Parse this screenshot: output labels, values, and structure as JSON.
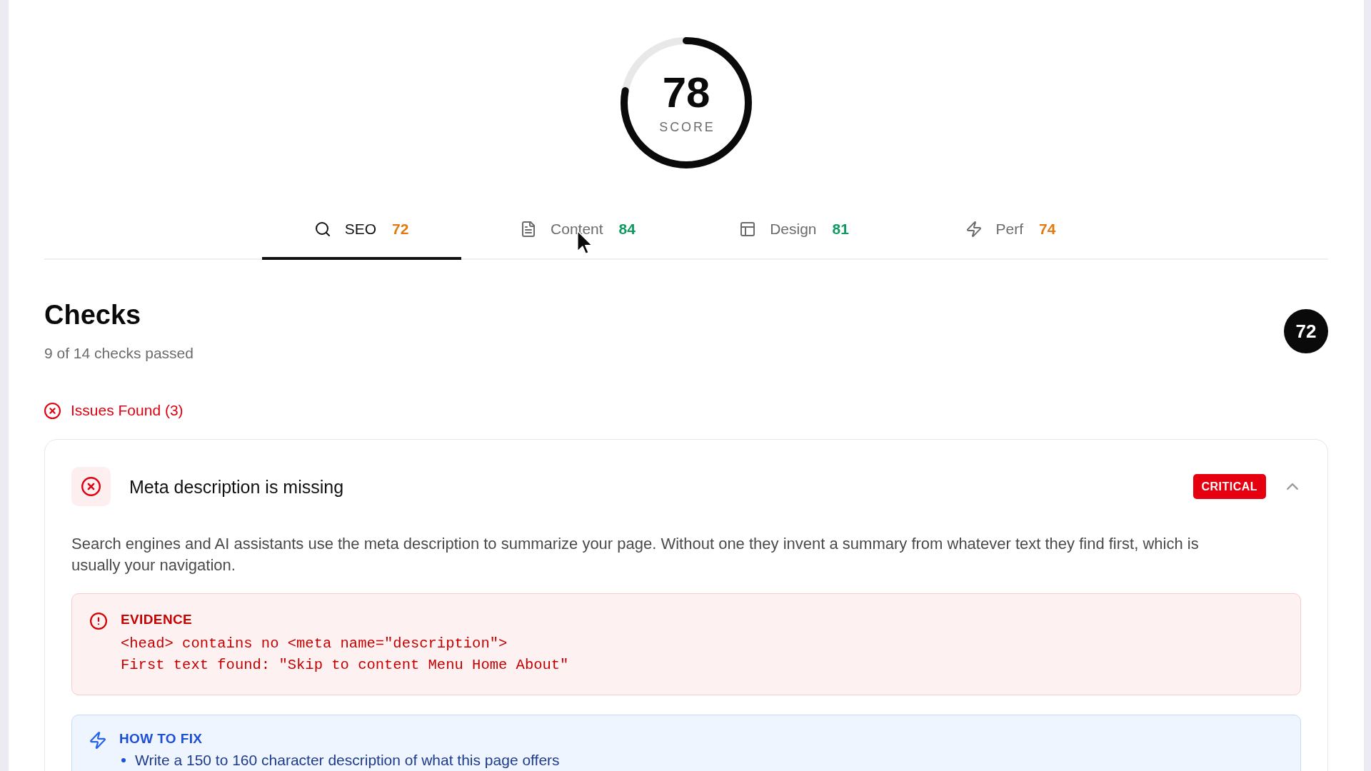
{
  "score": {
    "value": "78",
    "label": "SCORE",
    "level": 0.78
  },
  "tabs": [
    {
      "label": "SEO",
      "score": "72",
      "color": "#e27a0f",
      "selected": true
    },
    {
      "label": "Content",
      "score": "84",
      "color": "#0f9a60",
      "selected": false
    },
    {
      "label": "Design",
      "score": "81",
      "color": "#0f9a60",
      "selected": false
    },
    {
      "label": "Perf",
      "score": "74",
      "color": "#e27a0f",
      "selected": false
    }
  ],
  "checks": {
    "title": "Checks",
    "summary": "9 of 14 checks passed",
    "score": "72"
  },
  "issues_section": {
    "label": "Issues Found (3)"
  },
  "issues": [
    {
      "title": "Meta description is missing",
      "severity": "CRITICAL",
      "expanded": true,
      "description": "Search engines and AI assistants use the meta description to summarize your page. Without one they invent a summary from whatever text they find first, which is usually your navigation.",
      "evidence": {
        "label": "EVIDENCE",
        "lines": [
          "<head> contains no <meta name=\"description\">",
          "First text found: \"Skip to content Menu Home About\""
        ]
      },
      "fix": {
        "label": "HOW TO FIX",
        "steps": [
          "Write a 150 to 160 character description of what this page offers"
        ]
      }
    }
  ]
}
